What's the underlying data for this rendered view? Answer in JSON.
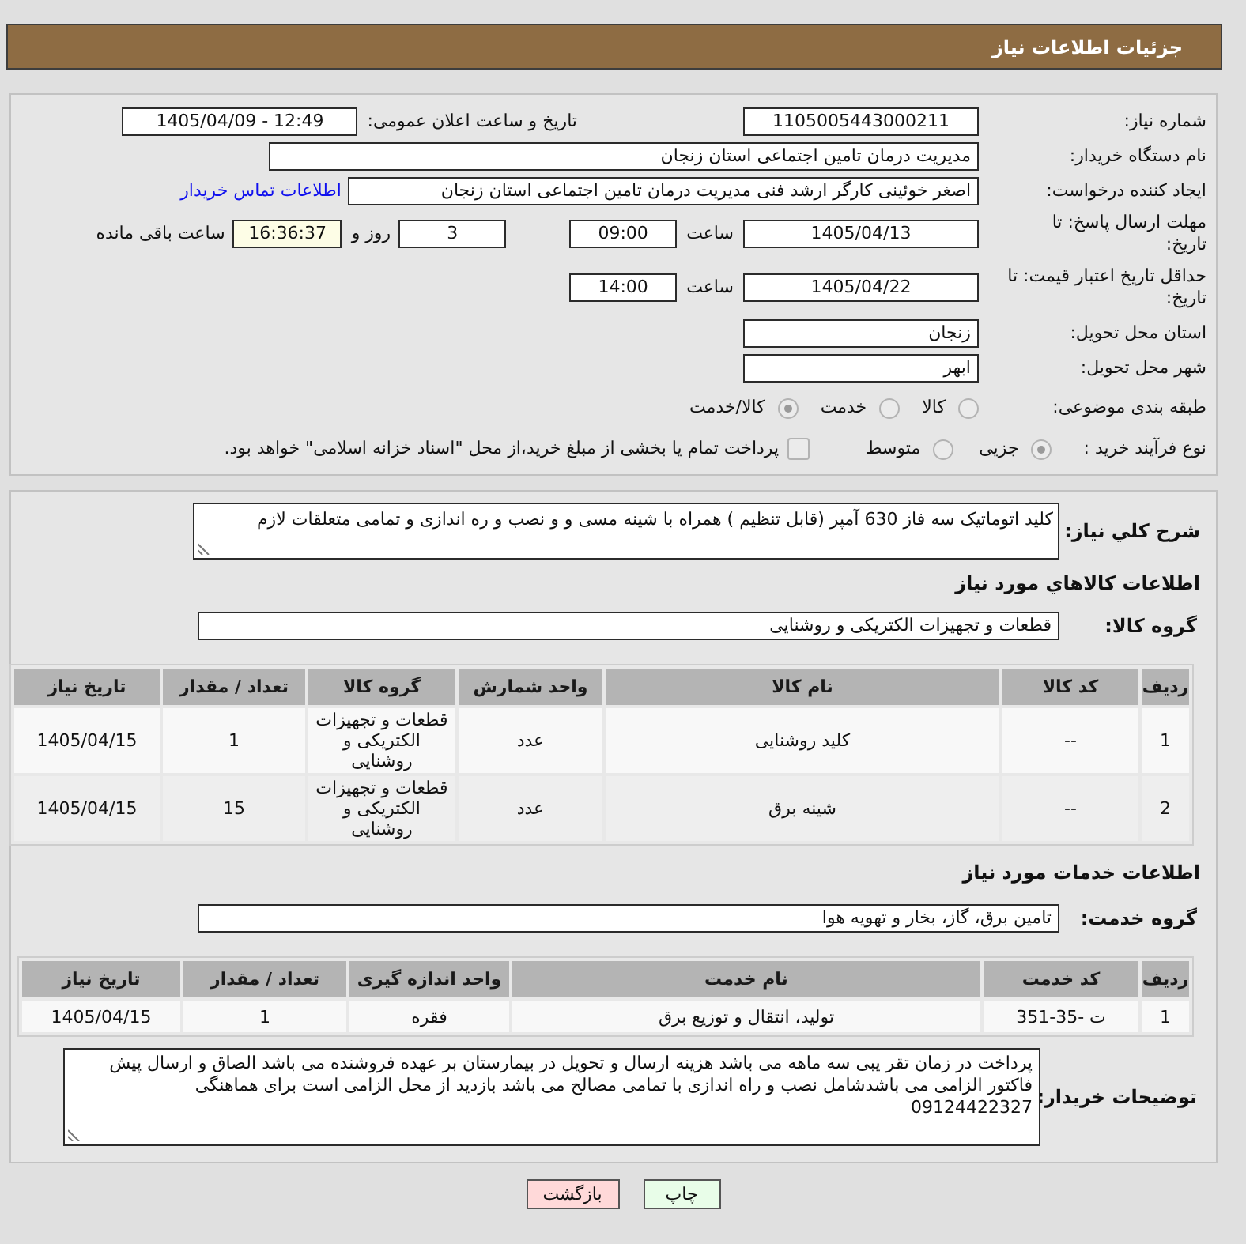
{
  "header": {
    "title": "جزئیات اطلاعات نیاز"
  },
  "details": {
    "need_number": {
      "label": "شماره نیاز:",
      "value": "1105005443000211"
    },
    "announce_datetime": {
      "label": "تاریخ و ساعت اعلان عمومی:",
      "value": "1405/04/09 - 12:49"
    },
    "buyer_org": {
      "label": "نام دستگاه خریدار:",
      "value": "مدیریت درمان تامین اجتماعی استان زنجان"
    },
    "requester": {
      "label": "ایجاد کننده درخواست:",
      "value": "اصغر خوئینی کارگر ارشد فنی مدیریت درمان تامین اجتماعی استان زنجان",
      "link": "اطلاعات تماس خریدار"
    },
    "response_deadline": {
      "label": "مهلت ارسال پاسخ: تا تاریخ:",
      "date": "1405/04/13",
      "time_label": "ساعت",
      "time": "09:00",
      "days": "3",
      "days_label": "روز و",
      "remaining": "16:36:37",
      "remaining_label": "ساعت باقی مانده"
    },
    "price_validity": {
      "label": "حداقل تاریخ اعتبار قیمت: تا تاریخ:",
      "date": "1405/04/22",
      "time_label": "ساعت",
      "time": "14:00"
    },
    "delivery_province": {
      "label": "استان محل تحویل:",
      "value": "زنجان"
    },
    "delivery_city": {
      "label": "شهر محل تحویل:",
      "value": "ابهر"
    },
    "subject_category": {
      "label": "طبقه بندی موضوعی:",
      "disabled": true,
      "options": [
        {
          "label": "کالا",
          "selected": false
        },
        {
          "label": "خدمت",
          "selected": false
        },
        {
          "label": "کالا/خدمت",
          "selected": true
        }
      ]
    },
    "purchase_process": {
      "label": "نوع فرآیند خرید :",
      "disabled": true,
      "options": [
        {
          "label": "جزیی",
          "selected": true
        },
        {
          "label": "متوسط",
          "selected": false
        }
      ],
      "treasury_checkbox": {
        "label": "پرداخت تمام یا بخشی از مبلغ خرید،از محل \"اسناد خزانه اسلامی\" خواهد بود.",
        "checked": false,
        "disabled": true
      }
    }
  },
  "need": {
    "label": "شرح کلي نياز:",
    "value": "کلید اتوماتیک سه فاز 630 آمپر (قابل تنظیم ) همراه با شینه مسی و و نصب و ره اندازی و تمامی متعلقات لازم"
  },
  "goods": {
    "heading": "اطلاعات کالاهاي مورد نياز",
    "group_label": "گروه کالا:",
    "group_value": "قطعات و تجهیزات الکتریکی و روشنایی",
    "table": {
      "columns": [
        "ردیف",
        "کد کالا",
        "نام کالا",
        "واحد شمارش",
        "گروه کالا",
        "تعداد / مقدار",
        "تاریخ نیاز"
      ],
      "rows": [
        [
          "1",
          "--",
          "کلید روشنایی",
          "عدد",
          "قطعات و تجهیزات الکتریکی و روشنایی",
          "1",
          "1405/04/15"
        ],
        [
          "2",
          "--",
          "شینه برق",
          "عدد",
          "قطعات و تجهیزات الکتریکی و روشنایی",
          "15",
          "1405/04/15"
        ]
      ]
    }
  },
  "services": {
    "heading": "اطلاعات خدمات مورد نياز",
    "group_label": "گروه خدمت:",
    "group_value": "تامین برق، گاز، بخار و تهویه هوا",
    "table": {
      "columns": [
        "ردیف",
        "کد خدمت",
        "نام خدمت",
        "واحد اندازه گیری",
        "تعداد / مقدار",
        "تاریخ نیاز"
      ],
      "rows": [
        [
          "1",
          "ت -35-351",
          "تولید، انتقال و توزیع برق",
          "فقره",
          "1",
          "1405/04/15"
        ]
      ]
    }
  },
  "buyer_notes": {
    "label": "توضیحات خریدار:",
    "value": "پرداخت در زمان تقر یبی سه ماهه می باشد هزینه ارسال و تحویل در بیمارستان بر عهده فروشنده می باشد الصاق و ارسال پیش فاکتور الزامی می باشدشامل نصب و راه اندازی با تمامی مصالح می باشد بازدید از محل الزامی است برای هماهنگی 09124422327"
  },
  "buttons": [
    {
      "kind": "print",
      "label": "چاپ"
    },
    {
      "kind": "back",
      "label": "بازگشت"
    }
  ]
}
